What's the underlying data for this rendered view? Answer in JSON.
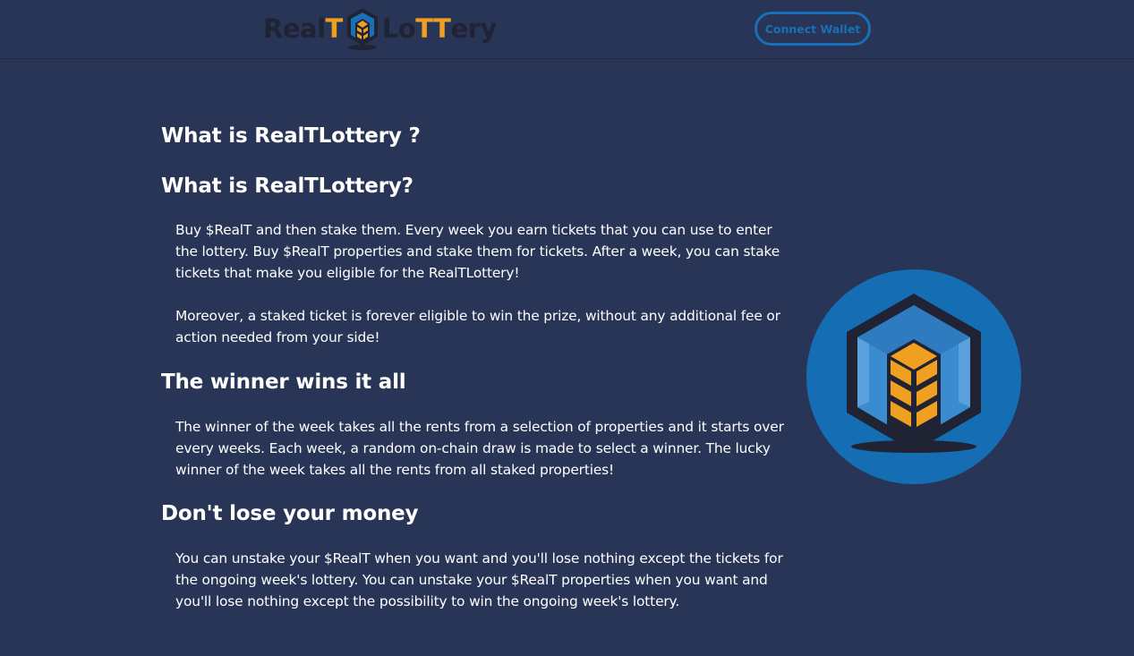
{
  "header": {
    "logo": {
      "part1": "Real",
      "part2": "T",
      "part3": "Lo",
      "part4": "TT",
      "part5": "ery",
      "icon": "cube-logo-icon"
    },
    "connect_wallet_label": "Connect Wallet"
  },
  "main": {
    "title": "What is RealTLottery ?",
    "sections": [
      {
        "heading": "What is RealTLottery?",
        "paragraphs": [
          "Buy $RealT and then stake them. Every week you earn tickets that you can use to enter the lottery. Buy $RealT properties and stake them for tickets. After a week, you can stake tickets that make you eligible for the RealTLottery!",
          "Moreover, a staked ticket is forever eligible to win the prize, without any additional fee or action needed from your side!"
        ]
      },
      {
        "heading": "The winner wins it all",
        "paragraphs": [
          "The winner of the week takes all the rents from a selection of properties and it starts over every weeks. Each week, a random on-chain draw is made to select a winner. The lucky winner of the week takes all the rents from all staked properties!"
        ]
      },
      {
        "heading": "Don't lose your money",
        "paragraphs": [
          "You can unstake your $RealT when you want and you'll lose nothing except the tickets for the ongoing week's lottery. You can unstake your $RealT properties when you want and you'll lose nothing except the possibility to win the ongoing week's lottery."
        ]
      }
    ],
    "hero_icon": "cube-building-icon"
  },
  "colors": {
    "background": "#283556",
    "accent_blue": "#1a6fb8",
    "accent_orange": "#f0a020",
    "logo_dark": "#1f2333"
  }
}
